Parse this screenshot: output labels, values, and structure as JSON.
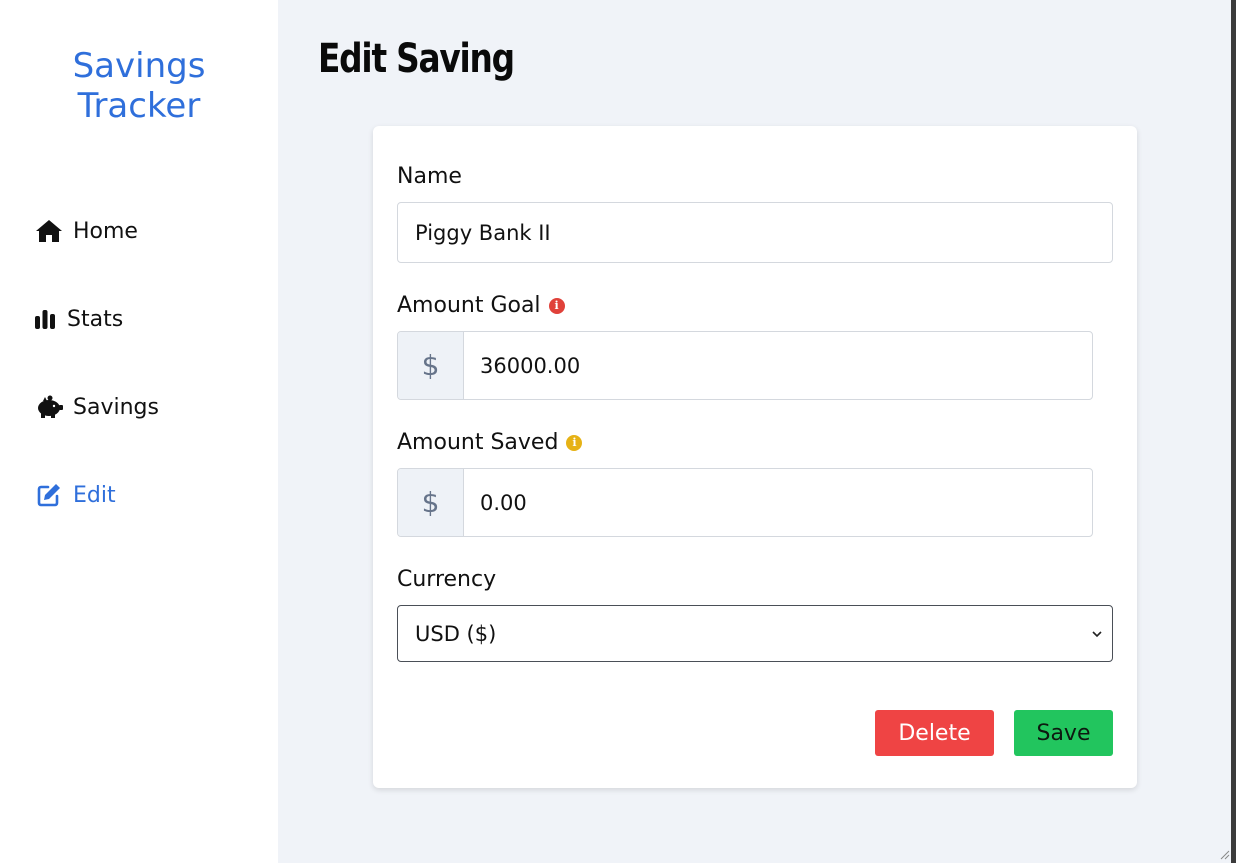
{
  "sidebar": {
    "brand_line1": "Savings",
    "brand_line2": "Tracker",
    "items": [
      {
        "label": "Home",
        "icon": "home-icon",
        "active": false
      },
      {
        "label": "Stats",
        "icon": "bar-chart-icon",
        "active": false
      },
      {
        "label": "Savings",
        "icon": "piggy-bank-icon",
        "active": false
      },
      {
        "label": "Edit",
        "icon": "edit-icon",
        "active": true
      }
    ]
  },
  "main": {
    "title": "Edit Saving",
    "form": {
      "name_label": "Name",
      "name_value": "Piggy Bank II",
      "goal_label": "Amount Goal",
      "goal_prefix": "$",
      "goal_value": "36000.00",
      "saved_label": "Amount Saved",
      "saved_prefix": "$",
      "saved_value": "0.00",
      "currency_label": "Currency",
      "currency_value": "USD ($)",
      "delete_label": "Delete",
      "save_label": "Save"
    }
  },
  "colors": {
    "accent": "#2f6fdb",
    "delete": "#ef4444",
    "save": "#22c55e",
    "goal_info": "#e0413a",
    "saved_info": "#e6b215"
  }
}
